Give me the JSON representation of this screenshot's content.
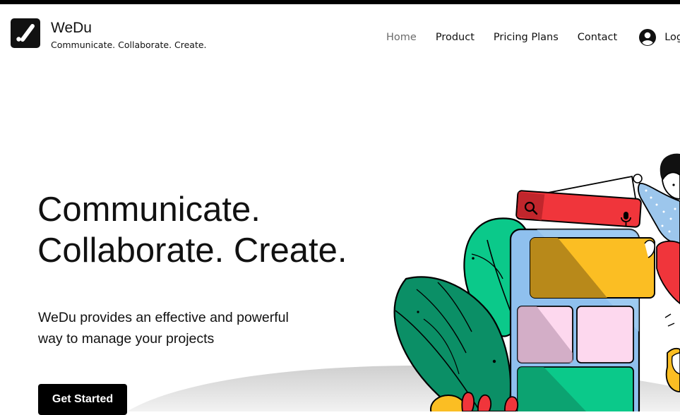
{
  "brand": {
    "name": "WeDu",
    "tagline": "Communicate. Collaborate. Create.",
    "logo_icon": "checkmark-slash-icon"
  },
  "nav": {
    "items": [
      {
        "label": "Home",
        "active": true
      },
      {
        "label": "Product",
        "active": false
      },
      {
        "label": "Pricing Plans",
        "active": false
      },
      {
        "label": "Contact",
        "active": false
      }
    ],
    "login_label": "Log",
    "login_icon": "user-circle-icon"
  },
  "hero": {
    "headline_line1": "Communicate.",
    "headline_line2": "Collaborate. Create.",
    "description_line1": "WeDu provides an effective and powerful",
    "description_line2": "way to manage your projects",
    "cta_label": "Get Started"
  },
  "colors": {
    "primary": "#000000",
    "search_bar": "#f0353b",
    "card_yellow": "#fbbe23",
    "card_pink": "#fdd8ee",
    "card_green": "#0bc98a",
    "phone_blue": "#8fc0ee",
    "leaf_green": "#0b8f66"
  }
}
